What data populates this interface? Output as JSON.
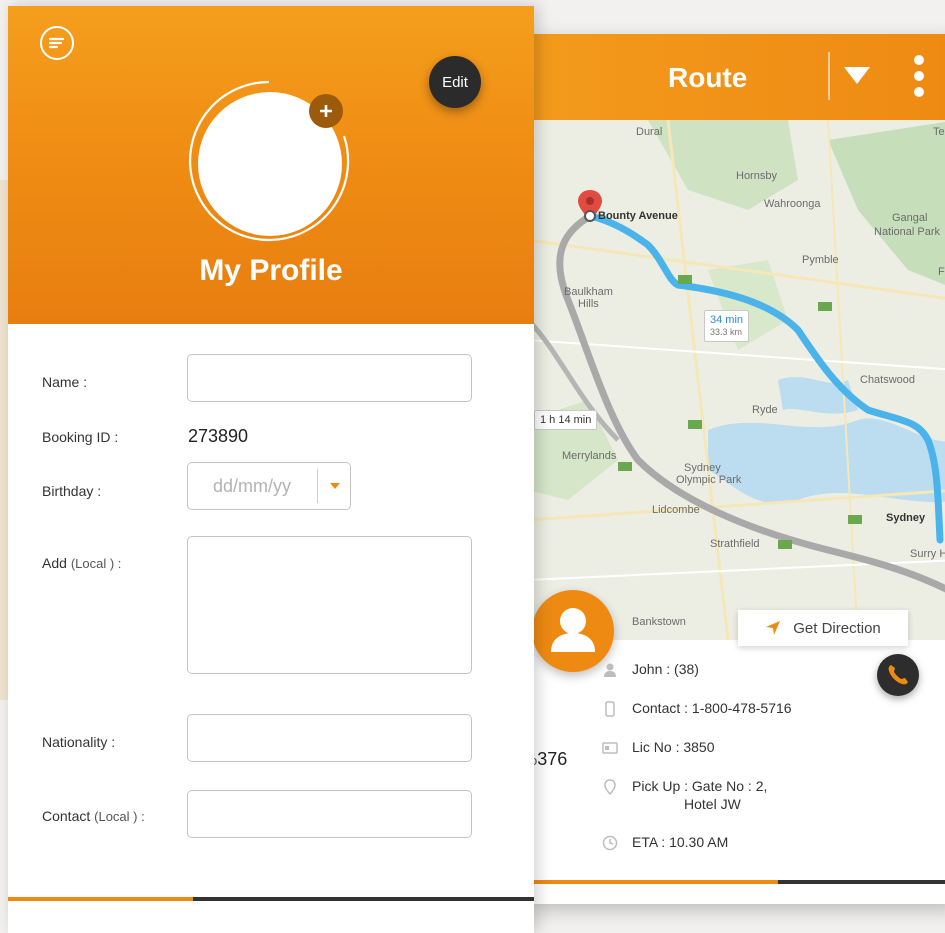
{
  "route": {
    "title": "Route",
    "get_direction_label": "Get Direction",
    "partial_value_prefix": "o",
    "partial_value": "376",
    "driver": {
      "name": "John : (38)",
      "contact": "Contact : 1-800-478-5716",
      "license": "Lic No : 3850",
      "pickup_line1": "Pick Up : Gate No : 2,",
      "pickup_line2": "Hotel JW",
      "eta": "ETA : 10.30 AM"
    },
    "map": {
      "labels": {
        "dural": "Dural",
        "hornsby": "Hornsby",
        "wahroonga": "Wahroonga",
        "gangal": "Gangal",
        "national_park": "National Park",
        "pymble": "Pymble",
        "baulkham": "Baulkham",
        "hills": "Hills",
        "chatswood": "Chatswood",
        "ryde": "Ryde",
        "merrylands": "Merrylands",
        "sydney_olympic": "Sydney",
        "olympic_park": "Olympic Park",
        "lidcombe": "Lidcombe",
        "strathfield": "Strathfield",
        "sydney": "Sydney",
        "surry_hills": "Surry H",
        "bankstown": "Bankstown",
        "te": "Te",
        "fr": "Fr"
      },
      "destination": "Bounty Avenue",
      "fast_route_time": "34 min",
      "fast_route_distance": "33.3 km",
      "slow_route_time": "1 h 14 min"
    },
    "colors": {
      "accent": "#ee8a12",
      "route_blue": "#4ab3ea",
      "route_grey": "#a9a9a9"
    }
  },
  "profile": {
    "title": "My Profile",
    "edit_label": "Edit",
    "fields": {
      "name_label": "Name :",
      "name_value": "",
      "booking_label": "Booking ID :",
      "booking_value": "273890",
      "birthday_label": "Birthday :",
      "birthday_placeholder": "dd/mm/yy",
      "address_label": "Add",
      "address_sub": "(Local ) :",
      "nationality_label": "Nationality :",
      "contact_label": "Contact",
      "contact_sub": "(Local ) :"
    }
  },
  "icons": {
    "menu": "menu-icon",
    "edit": "edit-button",
    "add_photo": "plus-icon",
    "dropdown": "triangle-down-icon",
    "more": "kebab-icon",
    "navigate": "navigation-arrow-icon",
    "call": "phone-icon",
    "user": "user-icon",
    "mobile": "mobile-icon",
    "license": "id-card-icon",
    "pin": "location-pin-icon",
    "clock": "clock-icon"
  }
}
